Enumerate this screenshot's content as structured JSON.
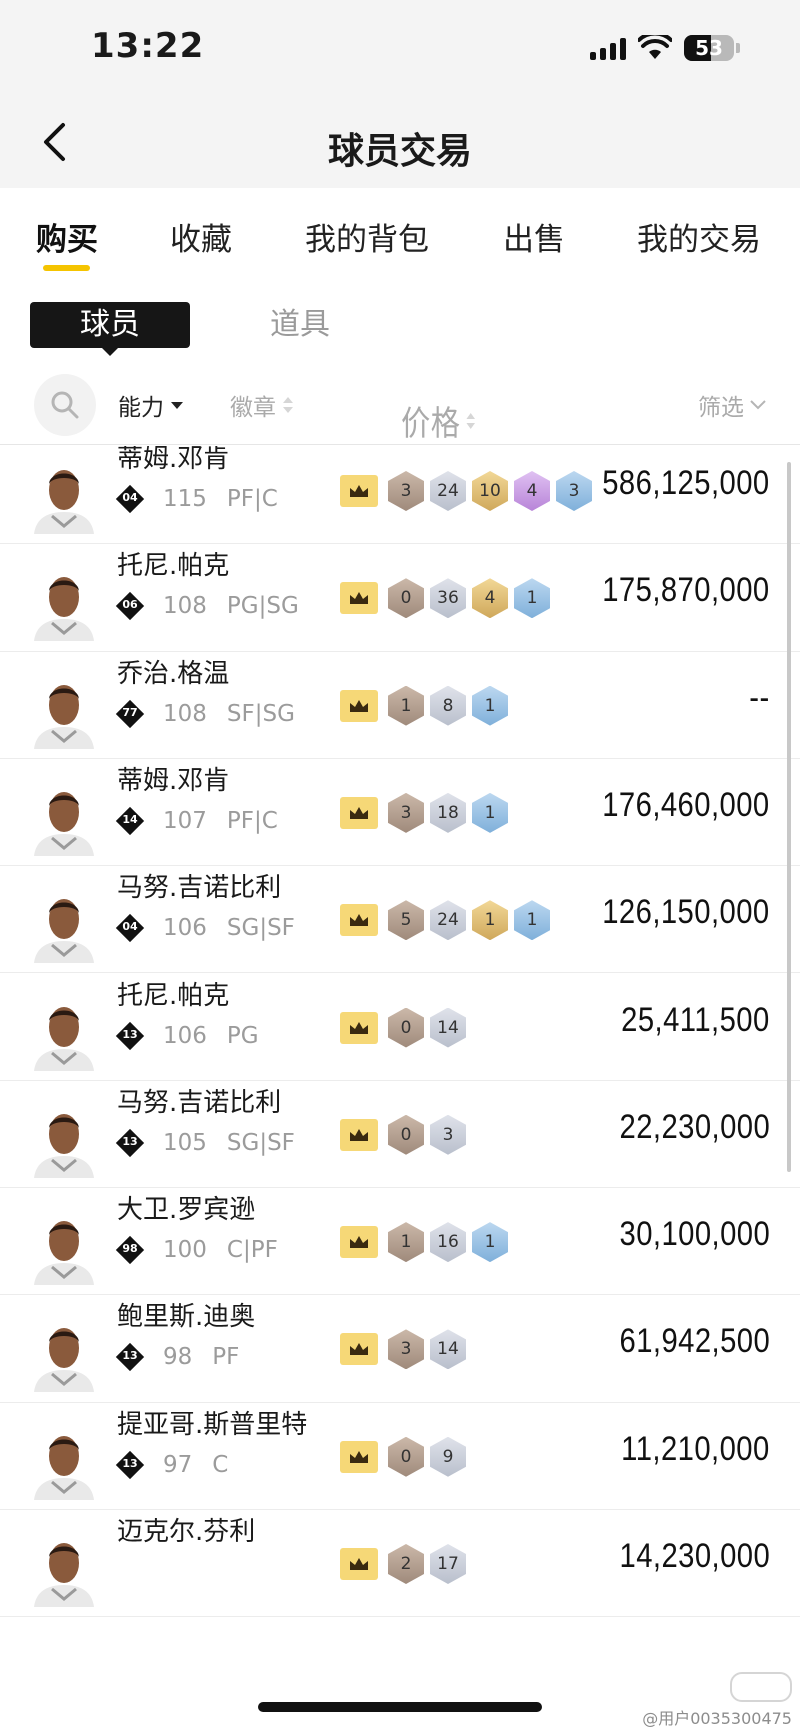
{
  "status": {
    "time": "13:22",
    "battery": "53",
    "battery_level": 0.53
  },
  "header": {
    "title": "球员交易"
  },
  "tabs": [
    {
      "label": "购买",
      "active": true
    },
    {
      "label": "收藏",
      "active": false
    },
    {
      "label": "我的背包",
      "active": false
    },
    {
      "label": "出售",
      "active": false
    },
    {
      "label": "我的交易",
      "active": false
    }
  ],
  "segment": {
    "player": "球员",
    "item": "道具"
  },
  "sort": {
    "ability": "能力",
    "badge": "徽章",
    "price": "价格",
    "filter": "筛选"
  },
  "colors": {
    "accent": "#f5c400",
    "crown": "#f6d877"
  },
  "players": [
    {
      "name": "蒂姆.邓肯",
      "jersey": "04",
      "overall": "115",
      "position": "PF|C",
      "badges": [
        [
          "hof",
          "3"
        ],
        [
          "gold",
          "24"
        ],
        [
          "silver",
          "10"
        ],
        [
          "purple",
          "4"
        ],
        [
          "blue",
          "3"
        ]
      ],
      "price": "586,125,000"
    },
    {
      "name": "托尼.帕克",
      "jersey": "06",
      "overall": "108",
      "position": "PG|SG",
      "badges": [
        [
          "hof",
          "0"
        ],
        [
          "gold",
          "36"
        ],
        [
          "silver",
          "4"
        ],
        [
          "blue",
          "1"
        ]
      ],
      "price": "175,870,000"
    },
    {
      "name": "乔治.格温",
      "jersey": "77",
      "overall": "108",
      "position": "SF|SG",
      "badges": [
        [
          "hof",
          "1"
        ],
        [
          "gold",
          "8"
        ],
        [
          "blue",
          "1"
        ]
      ],
      "price": "--"
    },
    {
      "name": "蒂姆.邓肯",
      "jersey": "14",
      "overall": "107",
      "position": "PF|C",
      "badges": [
        [
          "hof",
          "3"
        ],
        [
          "gold",
          "18"
        ],
        [
          "blue",
          "1"
        ]
      ],
      "price": "176,460,000"
    },
    {
      "name": "马努.吉诺比利",
      "jersey": "04",
      "overall": "106",
      "position": "SG|SF",
      "badges": [
        [
          "hof",
          "5"
        ],
        [
          "gold",
          "24"
        ],
        [
          "silver",
          "1"
        ],
        [
          "blue",
          "1"
        ]
      ],
      "price": "126,150,000"
    },
    {
      "name": "托尼.帕克",
      "jersey": "13",
      "overall": "106",
      "position": "PG",
      "badges": [
        [
          "hof",
          "0"
        ],
        [
          "gold",
          "14"
        ]
      ],
      "price": "25,411,500"
    },
    {
      "name": "马努.吉诺比利",
      "jersey": "13",
      "overall": "105",
      "position": "SG|SF",
      "badges": [
        [
          "hof",
          "0"
        ],
        [
          "gold",
          "3"
        ]
      ],
      "price": "22,230,000"
    },
    {
      "name": "大卫.罗宾逊",
      "jersey": "98",
      "overall": "100",
      "position": "C|PF",
      "badges": [
        [
          "hof",
          "1"
        ],
        [
          "gold",
          "16"
        ],
        [
          "blue",
          "1"
        ]
      ],
      "price": "30,100,000"
    },
    {
      "name": "鲍里斯.迪奥",
      "jersey": "13",
      "overall": "98",
      "position": "PF",
      "badges": [
        [
          "hof",
          "3"
        ],
        [
          "gold",
          "14"
        ]
      ],
      "price": "61,942,500"
    },
    {
      "name": "提亚哥.斯普里特",
      "jersey": "13",
      "overall": "97",
      "position": "C",
      "badges": [
        [
          "hof",
          "0"
        ],
        [
          "gold",
          "9"
        ]
      ],
      "price": "11,210,000"
    },
    {
      "name": "迈克尔.芬利",
      "jersey": "",
      "overall": "",
      "position": "",
      "badges": [
        [
          "hof",
          "2"
        ],
        [
          "gold",
          "17"
        ]
      ],
      "price": "14,230,000"
    }
  ],
  "watermark": "@用户0035300475"
}
